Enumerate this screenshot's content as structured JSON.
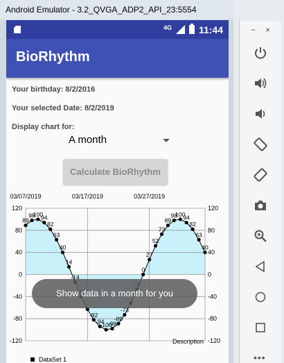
{
  "emulator": {
    "window_title": "Android Emulator - 3.2_QVGA_ADP2_API_23:5554",
    "minimize_glyph": "−",
    "close_glyph": "×",
    "controls": [
      "power-icon",
      "volume-up-icon",
      "volume-down-icon",
      "rotate-left-icon",
      "rotate-right-icon",
      "camera-icon",
      "zoom-icon",
      "back-icon",
      "home-icon",
      "overview-icon"
    ]
  },
  "status_bar": {
    "network": "4G",
    "time": "11:44"
  },
  "app": {
    "title": "BioRhythm",
    "birthday_label": "Your birthday: 8/2/2016",
    "selected_date_label": "Your selected Date: 8/2/2019",
    "display_chart_label": "Display chart for:",
    "spinner_value": "A month",
    "calculate_button": "Calculate BioRhythm"
  },
  "toast": {
    "message": "Show data in a month for you"
  },
  "colors": {
    "primary": "#3f51b5",
    "primary_dark": "#303f9f",
    "fill": "#c9f1f9",
    "line": "#000000"
  },
  "chart_data": {
    "type": "line",
    "title": "",
    "x_labels": [
      {
        "index": 0,
        "label": "03/07/2019"
      },
      {
        "index": 10,
        "label": "03/17/2019"
      },
      {
        "index": 20,
        "label": "03/27/2019"
      }
    ],
    "ylim": [
      -120,
      120
    ],
    "y_ticks": [
      120,
      80,
      40,
      0,
      -40,
      -80,
      -120
    ],
    "grid": true,
    "legend": {
      "position": "bottom-left",
      "entries": [
        "DataSet 1"
      ]
    },
    "description": "Description",
    "filled": true,
    "series": [
      {
        "name": "DataSet 1",
        "values": [
          89,
          98,
          100,
          94,
          82,
          63,
          40,
          14,
          -14,
          -40,
          -63,
          -82,
          -94,
          -100,
          -98,
          -89,
          -73,
          -52,
          -27,
          0,
          27,
          52,
          73,
          89,
          98,
          100,
          94,
          82,
          63,
          40
        ]
      }
    ],
    "data_labels_visible": [
      {
        "index": 0,
        "text": "89"
      },
      {
        "index": 1,
        "text": "98"
      },
      {
        "index": 2,
        "text": "100"
      },
      {
        "index": 3,
        "text": "94"
      },
      {
        "index": 4,
        "text": "82"
      },
      {
        "index": 5,
        "text": "63"
      },
      {
        "index": 6,
        "text": "40"
      },
      {
        "index": 7,
        "text": "14"
      },
      {
        "index": 8,
        "text": "-14"
      },
      {
        "index": 9,
        "text": "-40"
      },
      {
        "index": 11,
        "text": "-82"
      },
      {
        "index": 12,
        "text": "-94"
      },
      {
        "index": 13,
        "text": "-100"
      },
      {
        "index": 14,
        "text": "-98"
      },
      {
        "index": 15,
        "text": "-89"
      },
      {
        "index": 16,
        "text": "-73"
      },
      {
        "index": 18,
        "text": "-27"
      },
      {
        "index": 19,
        "text": "0"
      },
      {
        "index": 20,
        "text": "27"
      },
      {
        "index": 21,
        "text": "52"
      },
      {
        "index": 22,
        "text": "73"
      },
      {
        "index": 23,
        "text": "89"
      },
      {
        "index": 24,
        "text": "98"
      },
      {
        "index": 25,
        "text": "100"
      },
      {
        "index": 26,
        "text": "94"
      },
      {
        "index": 27,
        "text": "82"
      },
      {
        "index": 28,
        "text": "63"
      },
      {
        "index": 29,
        "text": "40"
      }
    ]
  }
}
